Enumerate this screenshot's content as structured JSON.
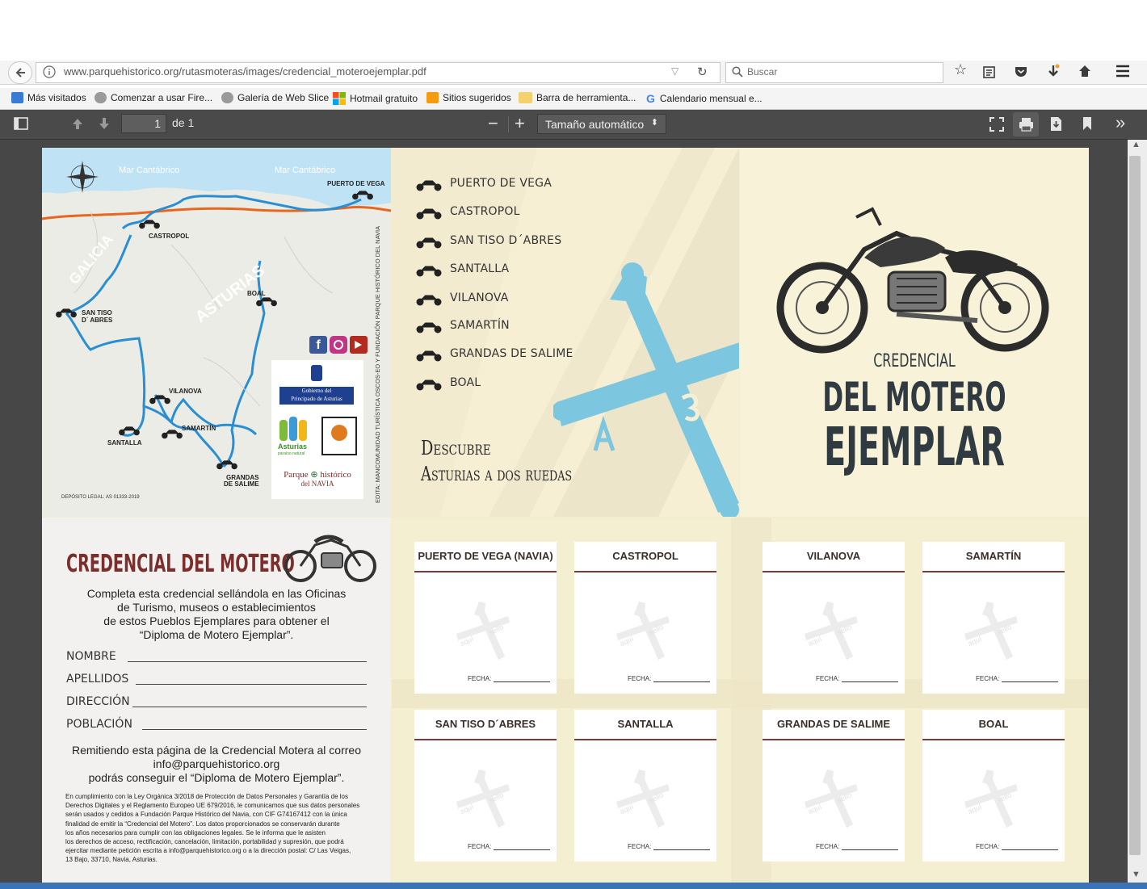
{
  "browser": {
    "url": "www.parquehistorico.org/rutasmoteras/images/credencial_moteroejemplar.pdf",
    "search_placeholder": "Buscar",
    "bookmarks": [
      {
        "label": "Más visitados",
        "icon": "monitor-icon",
        "color": "#3a7bd5"
      },
      {
        "label": "Comenzar a usar Fire...",
        "icon": "globe-icon",
        "color": "#8a8a8a"
      },
      {
        "label": "Galería de Web Slice",
        "icon": "globe-icon",
        "color": "#8a8a8a"
      },
      {
        "label": "Hotmail gratuito",
        "icon": "windows-icon",
        "color": "#e94e1b"
      },
      {
        "label": "Sitios sugeridos",
        "icon": "ie-icon",
        "color": "#f39c12"
      },
      {
        "label": "Barra de herramienta...",
        "icon": "folder-icon",
        "color": "#f3d26e"
      },
      {
        "label": "Calendario mensual e...",
        "icon": "google-icon",
        "color": "#4285f4"
      }
    ]
  },
  "pdf_toolbar": {
    "page_number": "1",
    "page_of": "de 1",
    "zoom_label": "Tamaño automático"
  },
  "map": {
    "sea_labels": [
      "Mar Cantábrico",
      "Mar Cantábrico"
    ],
    "region_labels": [
      "GALICIA",
      "ASTURIAS"
    ],
    "towns": {
      "puerto_de_vega": "PUERTO DE VEGA",
      "castropol": "CASTROPOL",
      "boal": "BOAL",
      "san_tiso_1": "SAN TISO",
      "san_tiso_2": "D´ ABRES",
      "vilanova": "VILANOVA",
      "samartin": "SAMARTÍN",
      "santalla": "SANTALLA",
      "grandas_1": "GRANDAS",
      "grandas_2": "DE SALIME"
    },
    "deposito": "DEPÓSITO LEGAL: AS 01333-2019",
    "vertical_credit": "EDITA: MANCOMUNIDAD TURÍSTICA OSCOS-EO Y FUNDACIÓN PARQUE HISTÓRICO DEL NAVIA",
    "gov_line1": "Gobierno del",
    "gov_line2": "Principado de Asturias",
    "asturias_logo": "Asturias",
    "asturias_sub": "paraíso natural",
    "parque_logo_1": "Parque",
    "parque_logo_2": "histórico",
    "parque_logo_3": "del NAVIA"
  },
  "route_list": {
    "items": [
      "PUERTO DE VEGA",
      "CASTROPOL",
      "SAN TISO D´ABRES",
      "SANTALLA",
      "VILANOVA",
      "SAMARTÍN",
      "GRANDAS DE SALIME",
      "BOAL"
    ],
    "tagline_1": "Descubre",
    "tagline_2": "Asturias a dos ruedas"
  },
  "cover": {
    "title_1": "CREDENCIAL",
    "title_2": "DEL MOTERO",
    "title_3": "EJEMPLAR"
  },
  "form": {
    "heading": "CREDENCIAL DEL MOTERO",
    "intro_1": "Completa esta credencial sellándola en las Oficinas",
    "intro_2": "de Turismo, museos o establecimientos",
    "intro_3": "de estos Pueblos Ejemplares para obtener el",
    "intro_4": "“Diploma de Motero Ejemplar”.",
    "fields": [
      "NOMBRE",
      "APELLIDOS",
      "DIRECCIÓN",
      "POBLACIÓN"
    ],
    "remit_1": "Remitiendo esta página de la Credencial Motera al correo",
    "remit_2": "info@parquehistorico.org",
    "remit_3": "podrás conseguir el “Diploma de Motero Ejemplar”.",
    "legal": [
      "En cumplimiento con la Ley Orgánica 3/2018 de Protección de Datos Personales y Garantía de los",
      "Derechos Digitales y el Reglamento Europeo UE 679/2016, le comunicamos que sus datos personales",
      "serán usados y cedidos a Fundación Parque Histórico del Navia, con CIF G74167412 con la única",
      "finalidad de emitir la “Credencial del Motero”. Los datos proporcionados se conservarán durante",
      "los años necesarios para cumplir con las obligaciones legales. Se le informa que le asisten",
      "los derechos de acceso, rectificación, cancelación, limitación, portabilidad y supresión, que podrá",
      "ejercitar mediante petición escrita a info@parquehistorico.org o a la dirección postal: C/ Las Veigas,",
      "13 Bajo, 33710, Navia, Asturias."
    ]
  },
  "stamps": {
    "fecha_label": "FECHA:",
    "ghost_1": "aquí",
    "ghost_2": "sello",
    "boxes": [
      "PUERTO DE VEGA (NAVIA)",
      "CASTROPOL",
      "VILANOVA",
      "SAMARTÍN",
      "SAN TISO D´ABRES",
      "SANTALLA",
      "GRANDAS DE SALIME",
      "BOAL"
    ]
  },
  "colors": {
    "cross_blue": "#7cc6df",
    "heading_red": "#7a2f2c",
    "title_dark": "#2f3a41",
    "route_blue": "#2a8fd2",
    "road_orange": "#e8661e"
  }
}
